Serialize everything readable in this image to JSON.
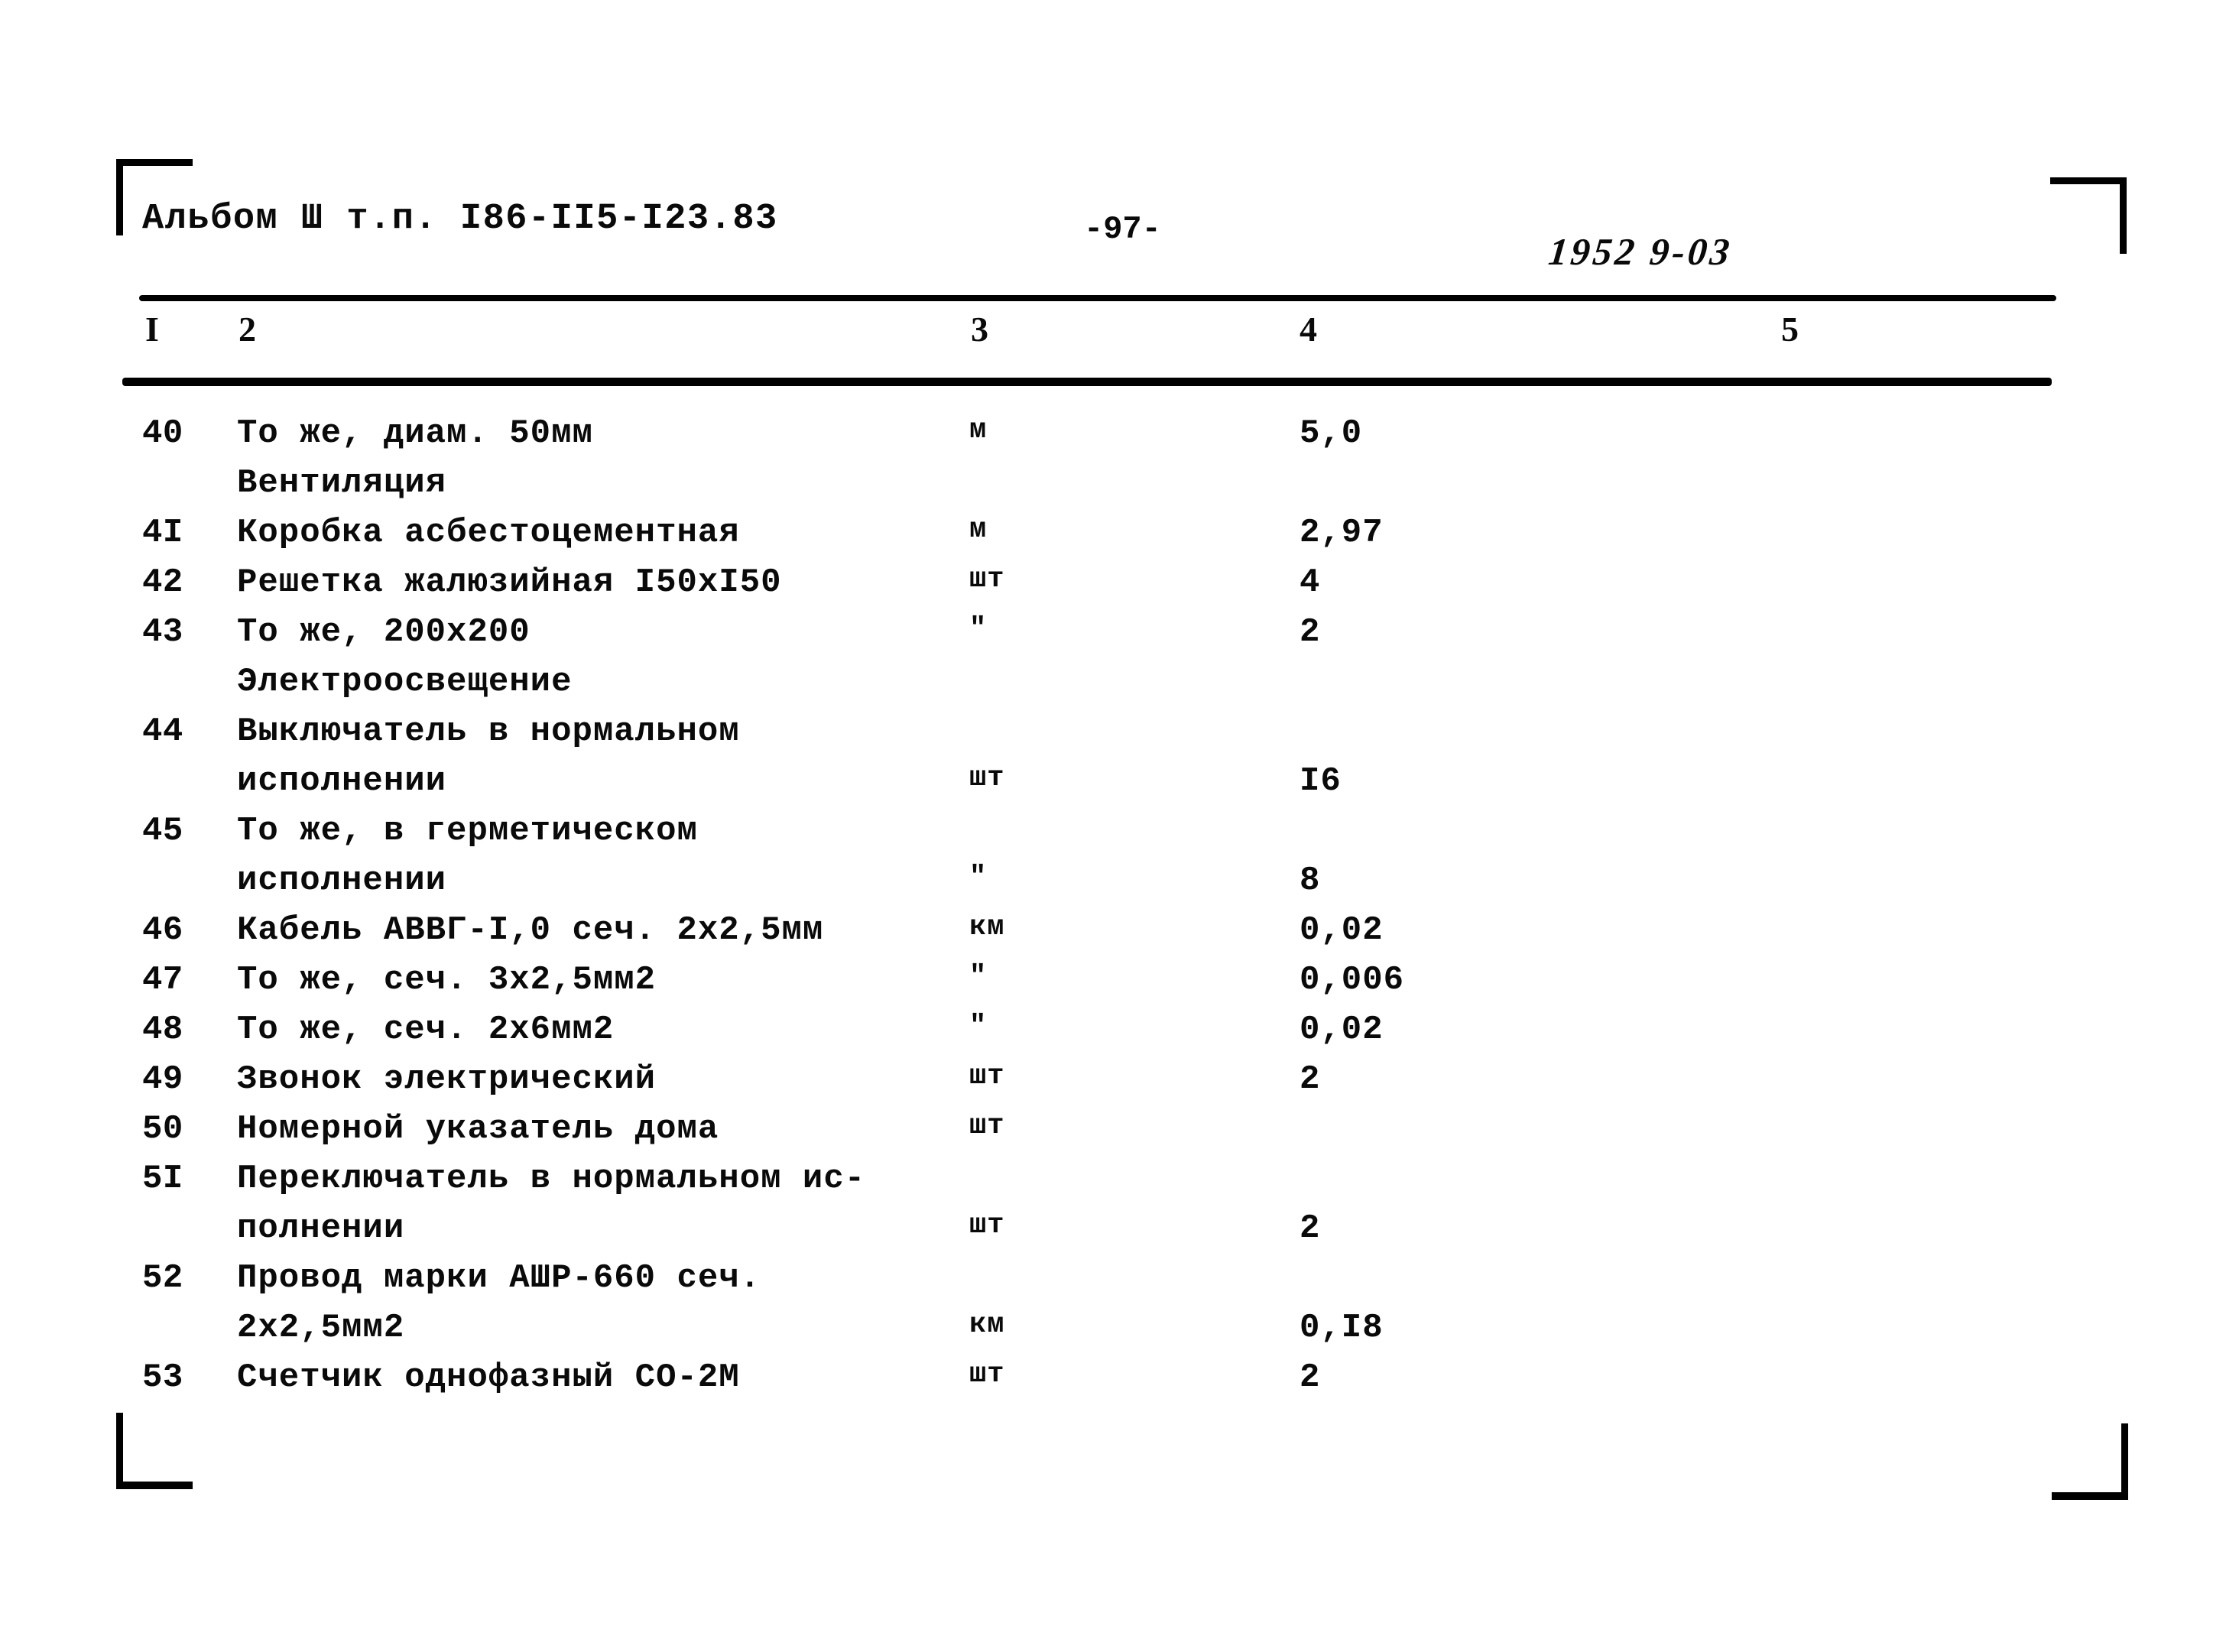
{
  "document": {
    "album_ref": "Альбом Ш т.п. I86-II5-I23.83",
    "page_number": "-97-",
    "doc_stamp": "1952 9-03"
  },
  "table": {
    "column_headers": [
      "I",
      "2",
      "3",
      "4",
      "5"
    ],
    "rows": [
      {
        "kind": "item",
        "num": "40",
        "name": "То же, диам. 50мм",
        "unit": "м",
        "qty": "5,0",
        "note": ""
      },
      {
        "kind": "section",
        "num": "",
        "name": "Вентиляция",
        "unit": "",
        "qty": "",
        "note": ""
      },
      {
        "kind": "item",
        "num": "4I",
        "name": "Коробка асбестоцементная",
        "unit": "м",
        "qty": "2,97",
        "note": ""
      },
      {
        "kind": "item",
        "num": "42",
        "name": "Решетка жалюзийная I50xI50",
        "unit": "шт",
        "qty": "4",
        "note": ""
      },
      {
        "kind": "item",
        "num": "43",
        "name": "То же, 200х200",
        "unit": "\"",
        "qty": "2",
        "note": ""
      },
      {
        "kind": "section",
        "num": "",
        "name": "Электроосвещение",
        "unit": "",
        "qty": "",
        "note": ""
      },
      {
        "kind": "item",
        "num": "44",
        "name": "Выключатель в нормальном",
        "unit": "",
        "qty": "",
        "note": ""
      },
      {
        "kind": "cont",
        "num": "",
        "name": "исполнении",
        "unit": "шт",
        "qty": "I6",
        "note": ""
      },
      {
        "kind": "item",
        "num": "45",
        "name": "То же, в герметическом",
        "unit": "",
        "qty": "",
        "note": ""
      },
      {
        "kind": "cont",
        "num": "",
        "name": "исполнении",
        "unit": "\"",
        "qty": "8",
        "note": ""
      },
      {
        "kind": "item",
        "num": "46",
        "name": "Кабель АВВГ-I,0 сеч. 2х2,5мм",
        "unit": "км",
        "qty": "0,02",
        "note": ""
      },
      {
        "kind": "item",
        "num": "47",
        "name": "То же, сеч. 3х2,5мм2",
        "unit": "\"",
        "qty": "0,006",
        "note": ""
      },
      {
        "kind": "item",
        "num": "48",
        "name": "То же, сеч. 2х6мм2",
        "unit": "\"",
        "qty": "0,02",
        "note": ""
      },
      {
        "kind": "item",
        "num": "49",
        "name": "Звонок электрический",
        "unit": "шт",
        "qty": "2",
        "note": ""
      },
      {
        "kind": "item",
        "num": "50",
        "name": "Номерной указатель дома",
        "unit": "шт",
        "qty": "",
        "note": ""
      },
      {
        "kind": "item",
        "num": "5I",
        "name": "Переключатель в нормальном ис-",
        "unit": "",
        "qty": "",
        "note": ""
      },
      {
        "kind": "cont",
        "num": "",
        "name": "полнении",
        "unit": "шт",
        "qty": "2",
        "note": ""
      },
      {
        "kind": "item",
        "num": "52",
        "name": "Провод марки АШР-660 сеч.",
        "unit": "",
        "qty": "",
        "note": ""
      },
      {
        "kind": "cont",
        "num": "",
        "name": "2х2,5мм2",
        "unit": "км",
        "qty": "0,I8",
        "note": ""
      },
      {
        "kind": "item",
        "num": "53",
        "name": "Счетчик однофазный СО-2М",
        "unit": "шт",
        "qty": "2",
        "note": ""
      }
    ]
  },
  "colors": {
    "ink": "#0a0a0a",
    "paper": "#ffffff"
  }
}
